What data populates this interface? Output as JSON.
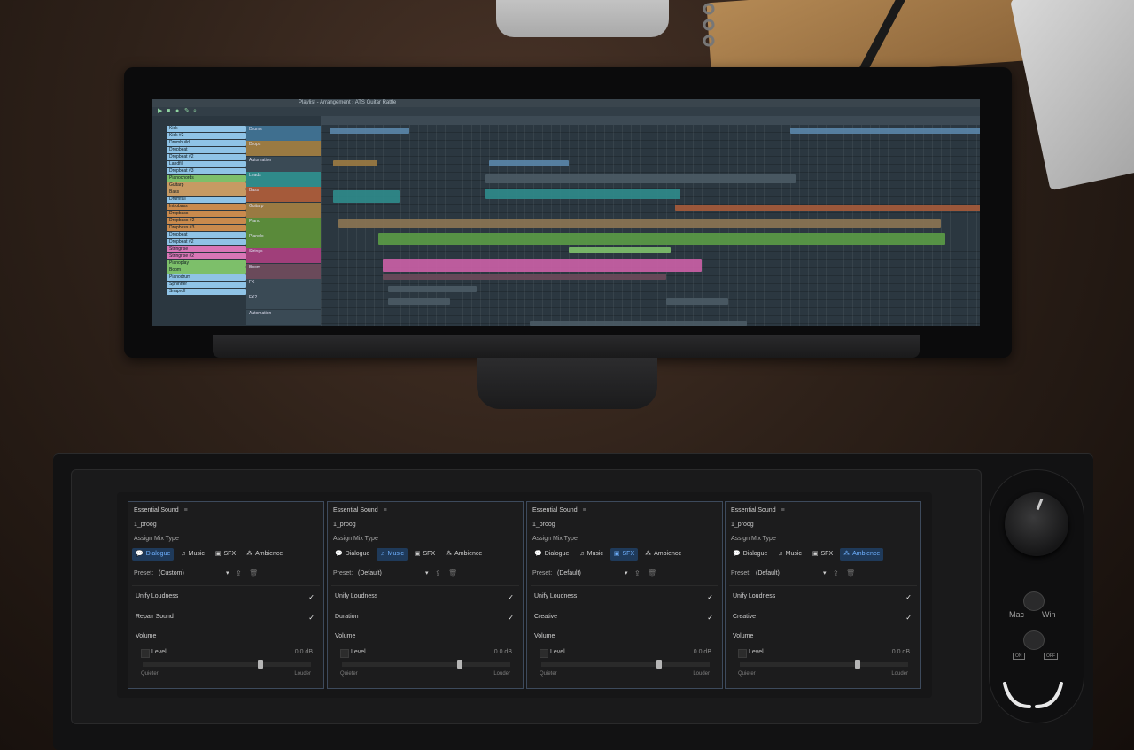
{
  "daw": {
    "title": "Playlist - Arrangement › ATS Guitar Rattle",
    "channels": [
      {
        "label": "Kick",
        "color": "#8fc3e6"
      },
      {
        "label": "Kick #2",
        "color": "#8fc3e6"
      },
      {
        "label": "Drumbuild",
        "color": "#8fc3e6"
      },
      {
        "label": "Dropbeat",
        "color": "#8fc3e6"
      },
      {
        "label": "Dropbeat #2",
        "color": "#8fc3e6"
      },
      {
        "label": "Landfill",
        "color": "#8fc3e6"
      },
      {
        "label": "Dropbeat #3",
        "color": "#8fc3e6"
      },
      {
        "label": "Pianochords",
        "color": "#7dbf6a"
      },
      {
        "label": "Guitarp",
        "color": "#c79a63"
      },
      {
        "label": "Bass",
        "color": "#c79a63"
      },
      {
        "label": "Drumfall",
        "color": "#8fc3e6"
      },
      {
        "label": "Introbass",
        "color": "#c98a4d"
      },
      {
        "label": "Dropbass",
        "color": "#c98a4d"
      },
      {
        "label": "Dropbass #2",
        "color": "#c98a4d"
      },
      {
        "label": "Dropbass #3",
        "color": "#c98a4d"
      },
      {
        "label": "Dropbeat",
        "color": "#8fc3e6"
      },
      {
        "label": "Dropbeat #2",
        "color": "#8fc3e6"
      },
      {
        "label": "Stringrise",
        "color": "#d976b6"
      },
      {
        "label": "Stringrise #2",
        "color": "#d976b6"
      },
      {
        "label": "Pianoplay",
        "color": "#7dbf6a"
      },
      {
        "label": "Boom",
        "color": "#7dbf6a"
      },
      {
        "label": "Pianodrum",
        "color": "#8fc3e6"
      },
      {
        "label": "Sphinner",
        "color": "#8fc3e6"
      },
      {
        "label": "Snaproll",
        "color": "#8fc3e6"
      }
    ],
    "tracks": [
      {
        "label": "Drums",
        "color": "#3f6f8f"
      },
      {
        "label": "Drops",
        "color": "#9a7a42"
      },
      {
        "label": "Automation",
        "color": "#3a4a55"
      },
      {
        "label": "Leads",
        "color": "#2f8a8a"
      },
      {
        "label": "Bass",
        "color": "#a55a3a"
      },
      {
        "label": "Guitarp",
        "color": "#9a7a42"
      },
      {
        "label": "Piano",
        "color": "#5a8a3a"
      },
      {
        "label": "Pianolo",
        "color": "#5a8a3a"
      },
      {
        "label": "Strings",
        "color": "#a03f7a"
      },
      {
        "label": "Boom",
        "color": "#6a4a5a"
      },
      {
        "label": "FX",
        "color": "#3a4a55"
      },
      {
        "label": "FX2",
        "color": "#3a4a55"
      },
      {
        "label": "Automation",
        "color": "#3a4a55"
      }
    ]
  },
  "panels": [
    {
      "title": "Essential Sound",
      "clip": "1_proog",
      "assign": "Assign Mix Type",
      "types": [
        "Dialogue",
        "Music",
        "SFX",
        "Ambience"
      ],
      "active_type": "Dialogue",
      "preset_label": "Preset:",
      "preset_value": "(Custom)",
      "row1": "Unify Loudness",
      "row2": "Repair Sound",
      "volume": "Volume",
      "level": "Level",
      "level_db": "0.0 dB",
      "quieter": "Quieter",
      "louder": "Louder",
      "slider_value": 0.7
    },
    {
      "title": "Essential Sound",
      "clip": "1_proog",
      "assign": "Assign Mix Type",
      "types": [
        "Dialogue",
        "Music",
        "SFX",
        "Ambience"
      ],
      "active_type": "Music",
      "preset_label": "Preset:",
      "preset_value": "(Default)",
      "row1": "Unify Loudness",
      "row2": "Duration",
      "volume": "Volume",
      "level": "Level",
      "level_db": "0.0 dB",
      "quieter": "Quieter",
      "louder": "Louder",
      "slider_value": 0.7
    },
    {
      "title": "Essential Sound",
      "clip": "1_proog",
      "assign": "Assign Mix Type",
      "types": [
        "Dialogue",
        "Music",
        "SFX",
        "Ambience"
      ],
      "active_type": "SFX",
      "preset_label": "Preset:",
      "preset_value": "(Default)",
      "row1": "Unify Loudness",
      "row2": "Creative",
      "volume": "Volume",
      "level": "Level",
      "level_db": "0.0 dB",
      "quieter": "Quieter",
      "louder": "Louder",
      "slider_value": 0.7
    },
    {
      "title": "Essential Sound",
      "clip": "1_proog",
      "assign": "Assign Mix Type",
      "types": [
        "Dialogue",
        "Music",
        "SFX",
        "Ambience"
      ],
      "active_type": "Ambience",
      "preset_label": "Preset:",
      "preset_value": "(Default)",
      "row1": "Unify Loudness",
      "row2": "Creative",
      "volume": "Volume",
      "level": "Level",
      "level_db": "0.0 dB",
      "quieter": "Quieter",
      "louder": "Louder",
      "slider_value": 0.7
    }
  ],
  "controls": {
    "mac": "Mac",
    "win": "Win",
    "on": "ON",
    "off": "OFF"
  },
  "colors": {
    "accent": "#6fb1ff",
    "active_bg": "#1f3a5a",
    "panel_border": "#3d4a5c"
  }
}
